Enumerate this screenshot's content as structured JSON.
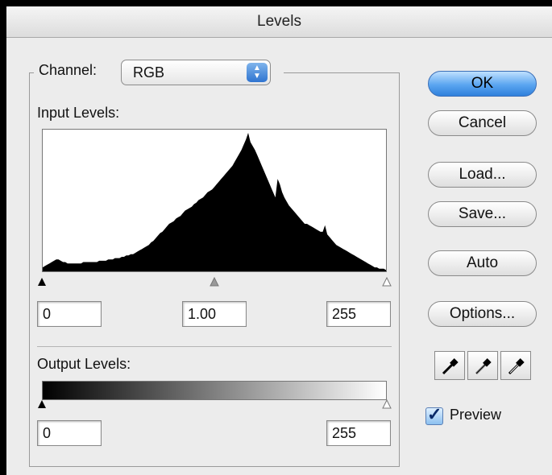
{
  "window": {
    "title": "Levels"
  },
  "channel": {
    "label": "Channel:",
    "value": "RGB"
  },
  "input_levels": {
    "label": "Input Levels:",
    "black": "0",
    "gamma": "1.00",
    "white": "255",
    "histogram": [
      3,
      4,
      5,
      6,
      7,
      8,
      9,
      9,
      8,
      7,
      7,
      6,
      6,
      6,
      6,
      6,
      6,
      6,
      7,
      7,
      7,
      7,
      7,
      7,
      7,
      8,
      8,
      8,
      8,
      9,
      9,
      9,
      10,
      10,
      10,
      11,
      11,
      12,
      12,
      13,
      13,
      14,
      15,
      16,
      17,
      18,
      19,
      20,
      22,
      23,
      25,
      27,
      29,
      30,
      32,
      34,
      36,
      37,
      38,
      40,
      41,
      42,
      44,
      46,
      47,
      48,
      49,
      51,
      52,
      54,
      55,
      56,
      58,
      60,
      61,
      62,
      64,
      66,
      68,
      70,
      72,
      74,
      76,
      78,
      80,
      83,
      86,
      89,
      92,
      96,
      100,
      105,
      98,
      95,
      92,
      88,
      84,
      80,
      76,
      72,
      68,
      64,
      60,
      56,
      70,
      66,
      60,
      56,
      53,
      50,
      48,
      46,
      44,
      42,
      40,
      38,
      36,
      36,
      35,
      34,
      33,
      32,
      31,
      30,
      30,
      35,
      28,
      26,
      24,
      22,
      20,
      19,
      18,
      17,
      16,
      15,
      14,
      13,
      12,
      11,
      10,
      9,
      8,
      7,
      6,
      5,
      4,
      3,
      3,
      2,
      2,
      2,
      1
    ]
  },
  "output_levels": {
    "label": "Output Levels:",
    "black": "0",
    "white": "255"
  },
  "buttons": {
    "ok": "OK",
    "cancel": "Cancel",
    "load": "Load...",
    "save": "Save...",
    "auto": "Auto",
    "options": "Options..."
  },
  "eyedroppers": [
    "black-eyedropper-icon",
    "gray-eyedropper-icon",
    "white-eyedropper-icon"
  ],
  "preview": {
    "label": "Preview",
    "checked": true
  },
  "colors": {
    "accent": "#2f80dc",
    "histogram": "#000000"
  }
}
